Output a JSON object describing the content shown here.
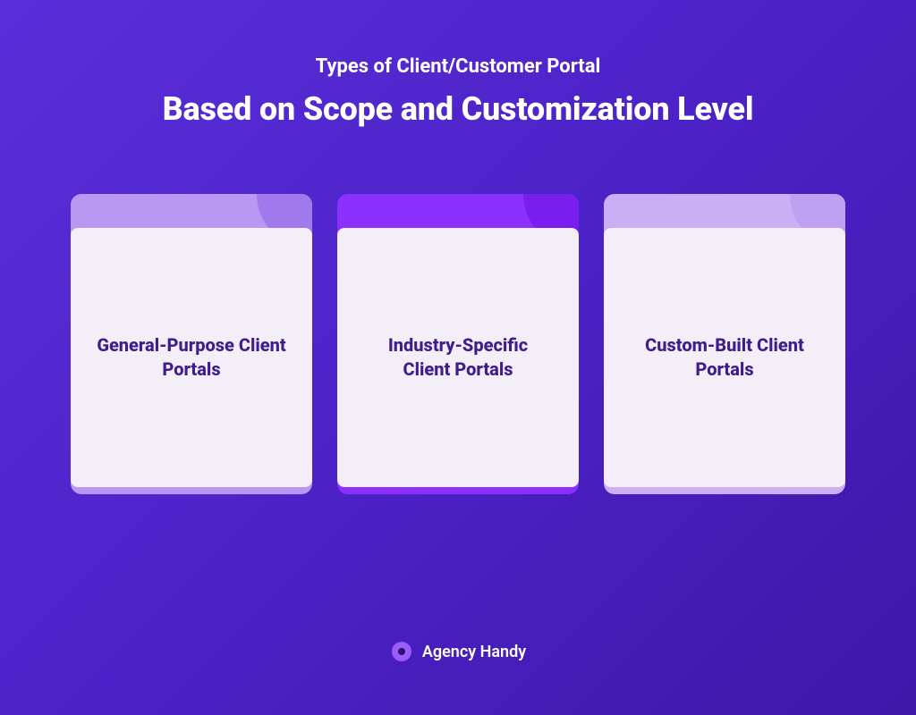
{
  "header": {
    "subtitle": "Types of Client/Customer Portal",
    "title": "Based on Scope and Customization Level"
  },
  "cards": [
    {
      "label": "General-Purpose Client Portals",
      "accent": "#b997f3",
      "bubble": "#a279ec"
    },
    {
      "label": "Industry-Specific Client Portals",
      "accent": "#8b30ff",
      "bubble": "#7a1ef0"
    },
    {
      "label": "Custom-Built Client Portals",
      "accent": "#c9b0f5",
      "bubble": "#bea2f2"
    }
  ],
  "footer": {
    "brand": "Agency Handy"
  }
}
